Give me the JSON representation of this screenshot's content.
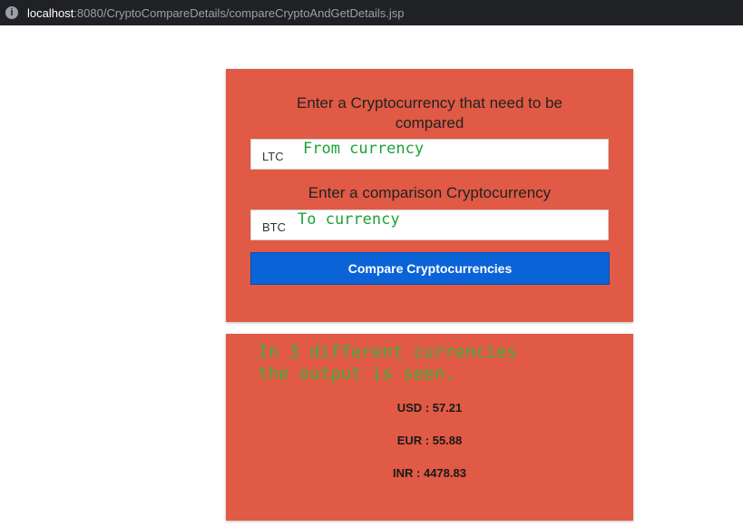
{
  "browser": {
    "host": "localhost",
    "path": ":8080/CryptoCompareDetails/compareCryptoAndGetDetails.jsp",
    "info_icon": "info-icon"
  },
  "form": {
    "prompt_from": "Enter a Cryptocurrency that need to be compared",
    "from_value": "LTC",
    "from_hint": "From currency",
    "prompt_to": "Enter a comparison Cryptocurrency",
    "to_value": "BTC",
    "to_hint": "To currency",
    "compare_button": "Compare Cryptocurrencies"
  },
  "results": {
    "note_line1": "In 3 different currencies",
    "note_line2": "the output is seen.",
    "usd": "USD : 57.21",
    "eur": "EUR : 55.88",
    "inr": "INR : 4478.83"
  },
  "colors": {
    "panel_bg": "#e05a45",
    "button_bg": "#0b63d8",
    "annotation_green": "#1aa336"
  }
}
